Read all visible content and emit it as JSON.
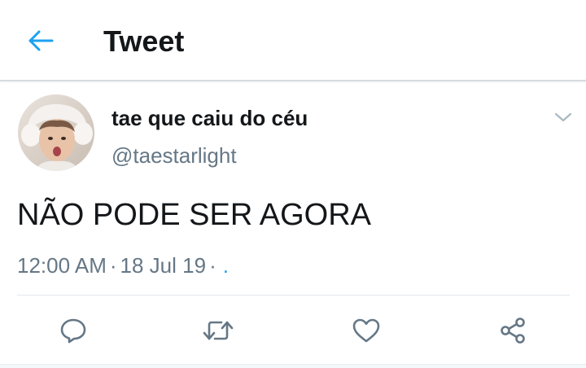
{
  "header": {
    "title": "Tweet",
    "back_icon": "arrow-left-icon",
    "accent_color": "#1da1f2"
  },
  "tweet": {
    "author": {
      "display_name": "tae que caiu do céu",
      "handle": "@taestarlight",
      "avatar": "avatar-photo"
    },
    "menu_icon": "chevron-down-icon",
    "text": "NÃO PODE SER AGORA",
    "time": "12:00 AM",
    "separator": "·",
    "date": "18 Jul 19",
    "source": "."
  },
  "actions": [
    {
      "name": "reply",
      "icon": "reply-icon"
    },
    {
      "name": "retweet",
      "icon": "retweet-icon"
    },
    {
      "name": "like",
      "icon": "heart-icon"
    },
    {
      "name": "share",
      "icon": "share-icon"
    }
  ],
  "colors": {
    "text_primary": "#14171a",
    "text_secondary": "#657786",
    "accent": "#1da1f2",
    "divider": "#e1e8ed"
  }
}
